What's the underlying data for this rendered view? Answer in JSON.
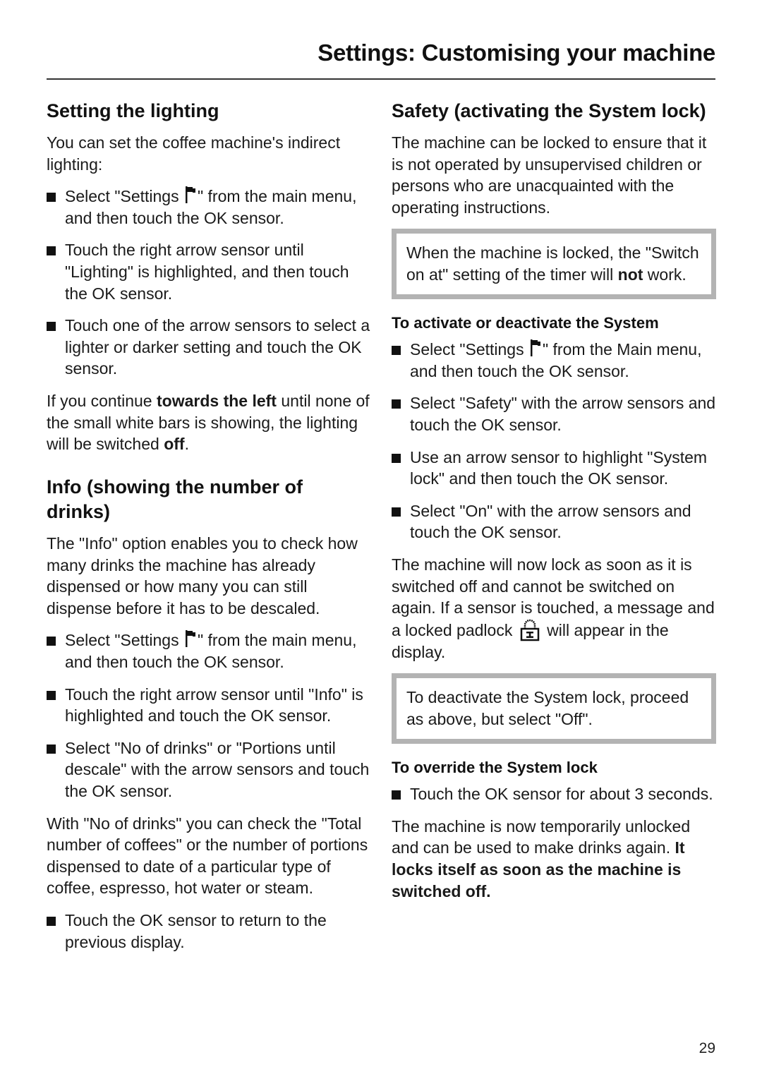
{
  "header": {
    "title": "Settings: Customising your machine"
  },
  "left": {
    "lighting": {
      "heading": "Setting the lighting",
      "intro": "You can set the coffee machine's indirect lighting:",
      "steps": [
        {
          "pre": "Select \"Settings ",
          "post": "\" from the main menu, and then touch the OK sensor."
        },
        {
          "text": "Touch the right arrow sensor until \"Lighting\" is highlighted, and then touch the OK sensor."
        },
        {
          "text": "Touch one of the arrow sensors to select a lighter or darker setting and touch the OK sensor."
        }
      ],
      "outro": {
        "t1": "If you continue ",
        "b1": "towards the left",
        "t2": " until none of the small white bars is showing, the lighting will be switched ",
        "b2": "off",
        "t3": "."
      }
    },
    "info": {
      "heading": "Info (showing the number of drinks)",
      "intro": "The \"Info\" option enables you to check how many drinks the machine has already dispensed or how many you can still dispense before it has to be descaled.",
      "steps": [
        {
          "pre": "Select \"Settings ",
          "post": "\" from the main menu, and then touch the OK sensor."
        },
        {
          "text": "Touch the right arrow sensor until \"Info\" is highlighted and touch the OK sensor."
        },
        {
          "text": "Select \"No of drinks\" or \"Portions until descale\" with the arrow sensors and touch the OK sensor."
        }
      ],
      "middle": "With \"No of drinks\" you can check the \"Total number of coffees\" or the number of portions dispensed to date of a particular type of coffee, espresso, hot water or steam.",
      "last_step": "Touch the OK sensor to return to the previous display."
    }
  },
  "right": {
    "safety": {
      "heading": "Safety (activating the System lock)",
      "intro": "The machine can be locked to ensure that it is not operated by unsupervised children or persons who are unacquainted with the operating instructions.",
      "note1": {
        "t1": "When the machine is locked, the \"Switch on at\" setting of the timer will ",
        "b1": "not",
        "t2": " work."
      },
      "activate_heading": "To activate or deactivate the System",
      "steps": [
        {
          "pre": "Select \"Settings ",
          "post": "\" from the Main menu, and then touch the OK sensor."
        },
        {
          "text": "Select \"Safety\" with the arrow sensors and touch the OK sensor."
        },
        {
          "text": "Use an arrow sensor to highlight \"System lock\" and then touch the OK sensor."
        },
        {
          "text": "Select \"On\" with the arrow sensors and touch the OK sensor."
        }
      ],
      "lock_para": {
        "pre": "The machine will now lock as soon as it is switched off and cannot be switched on again. If a sensor is touched, a message and a locked padlock ",
        "post": " will appear in the display."
      },
      "note2": "To deactivate the System lock, proceed as above, but select \"Off\".",
      "override_heading": "To override the System lock",
      "override_step": "Touch the OK sensor for about 3 seconds.",
      "final": {
        "t1": "The machine is now temporarily unlocked and can be used to make drinks again. ",
        "b1": "It locks itself as soon as the machine is switched off."
      }
    }
  },
  "footer": {
    "page_number": "29"
  }
}
